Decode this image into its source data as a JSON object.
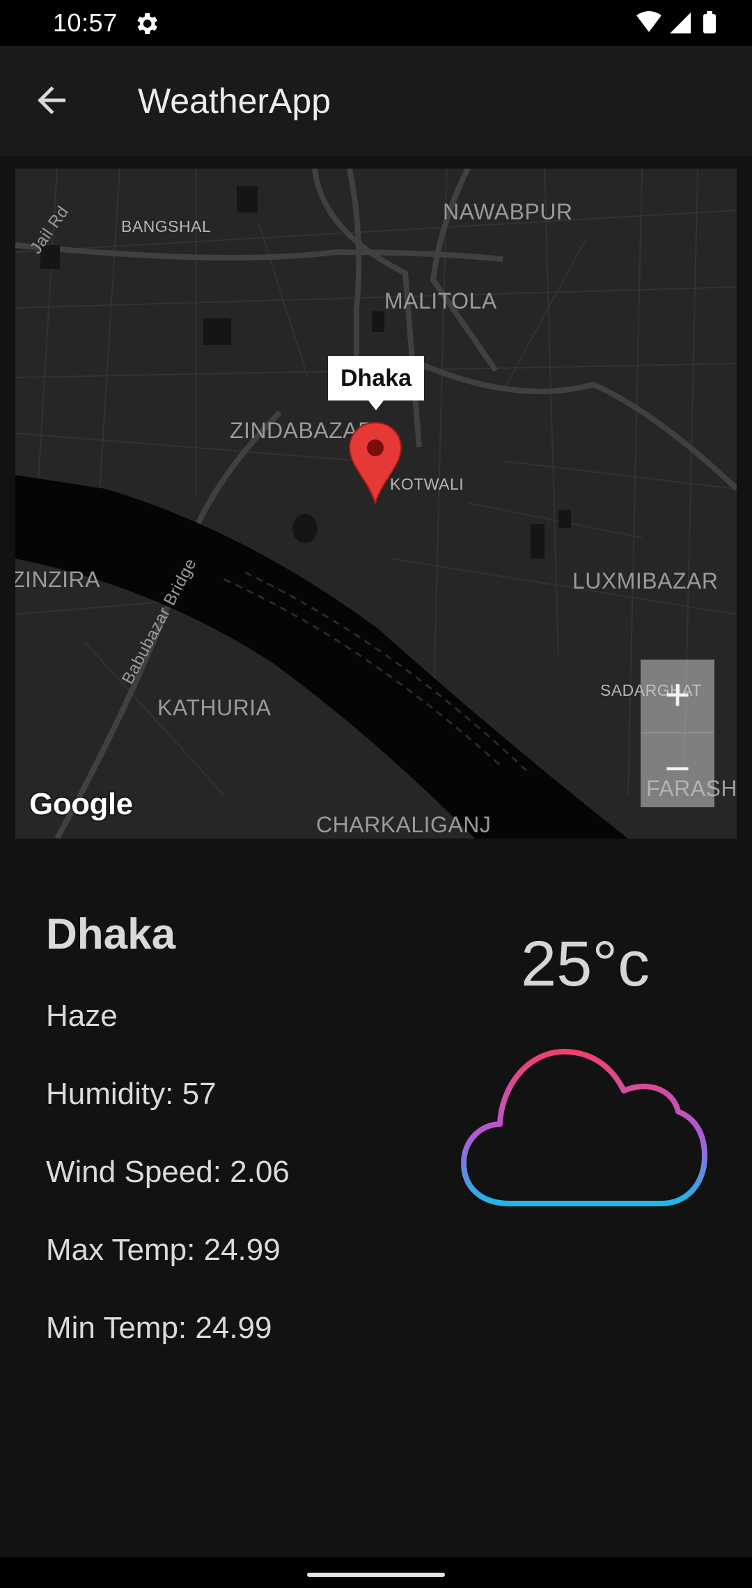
{
  "status_bar": {
    "time": "10:57",
    "icons": [
      "gear-icon",
      "wifi-icon",
      "signal-icon",
      "battery-icon"
    ]
  },
  "app_bar": {
    "title": "WeatherApp",
    "back_icon": "arrow-back-icon"
  },
  "map": {
    "labels": {
      "bangshal": "BANGSHAL",
      "nawabpur": "NAWABPUR",
      "jail_rd": "Jail Rd",
      "malitola": "MALITOLA",
      "zindabazar": "ZINDABAZAR",
      "kotwali": "KOTWALI",
      "zinzira": "ZINZIRA",
      "babubazar_bridge": "Babubazar Bridge",
      "luxmibazar": "LUXMIBAZAR",
      "kathuria": "KATHURIA",
      "sadarghat": "SADARGHAT",
      "farash": "FARASH",
      "charkaliganj": "CHARKALIGANJ"
    },
    "marker_title": "Dhaka",
    "zoom_in": "+",
    "zoom_out": "−",
    "attribution": "Google",
    "marker_color": "#e53935"
  },
  "weather": {
    "city": "Dhaka",
    "condition": "Haze",
    "humidity": "Humidity: 57",
    "wind_speed": "Wind Speed: 2.06",
    "max_temp": "Max Temp: 24.99",
    "min_temp": "Min Temp: 24.99",
    "temperature": "25°c",
    "icon": "cloud-icon"
  }
}
